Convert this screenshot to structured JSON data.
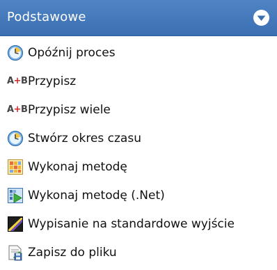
{
  "panel": {
    "title": "Podstawowe",
    "accent": "#3f74b8",
    "collapse_icon": "circle-chevron-down-icon"
  },
  "items": [
    {
      "label": "Opóźnij proces",
      "icon": "clock-icon"
    },
    {
      "label": "Przypisz",
      "icon": "assign-ab-icon"
    },
    {
      "label": "Przypisz wiele",
      "icon": "assign-ab-icon"
    },
    {
      "label": "Stwórz okres czasu",
      "icon": "clock-icon"
    },
    {
      "label": "Wykonaj metodę",
      "icon": "method-grid-icon"
    },
    {
      "label": "Wykonaj metodę (.Net)",
      "icon": "net-method-icon"
    },
    {
      "label": "Wypisanie na standardowe wyjście",
      "icon": "stdout-icon"
    },
    {
      "label": "Zapisz do pliku",
      "icon": "save-file-icon"
    }
  ]
}
